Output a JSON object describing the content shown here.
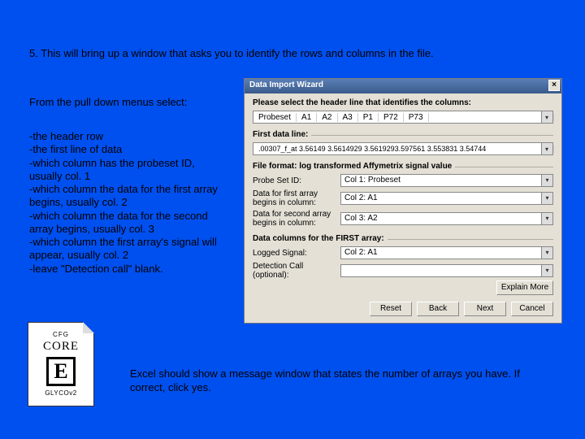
{
  "instructions": {
    "step": "5. This will bring up a window that asks you to identify the rows and columns in the file.",
    "pulldown": "From the pull down menus select:",
    "bullets": [
      "-the header row",
      "-the first line of data",
      "-which column has the probeset ID, usually col. 1",
      "-which column the data for the first array begins, usually col. 2",
      "-which column the data for the second array begins, usually col. 3",
      "-which column the first array's signal will appear, usually col. 2",
      "-leave \"Detection call\" blank."
    ],
    "footer": "Excel should show a message window that states the number of arrays you have.  If correct, click yes."
  },
  "wizard": {
    "title": "Data Import Wizard",
    "close": "×",
    "section1": "Please select the header line that identifies the columns:",
    "header_cols": [
      "Probeset",
      "A1",
      "A2",
      "A3",
      "P1",
      "P72",
      "P73"
    ],
    "first_data_label": "First data line:",
    "first_data_value": ".00307_f_at     3.56149 3.5614929 3.5619293.597561 3.553831 3.54744",
    "section2": "File format: log transformed Affymetrix signal value",
    "fields": [
      {
        "label": "Probe Set ID:",
        "value": "Col 1: Probeset"
      },
      {
        "label": "Data for first array begins in column:",
        "value": "Col 2: A1"
      },
      {
        "label": "Data for second array begins in column:",
        "value": "Col 3: A2"
      }
    ],
    "section3": "Data columns for the FIRST array:",
    "fields2": [
      {
        "label": "Logged Signal:",
        "value": "Col 2: A1"
      },
      {
        "label": "Detection Call (optional):",
        "value": ""
      }
    ],
    "explain": "Explain More",
    "buttons": [
      "Reset",
      "Back",
      "Next",
      "Cancel"
    ]
  },
  "logo": {
    "cfg": "CFG",
    "core": "CORE",
    "letter": "E",
    "glyco": "GLYCOv2"
  }
}
